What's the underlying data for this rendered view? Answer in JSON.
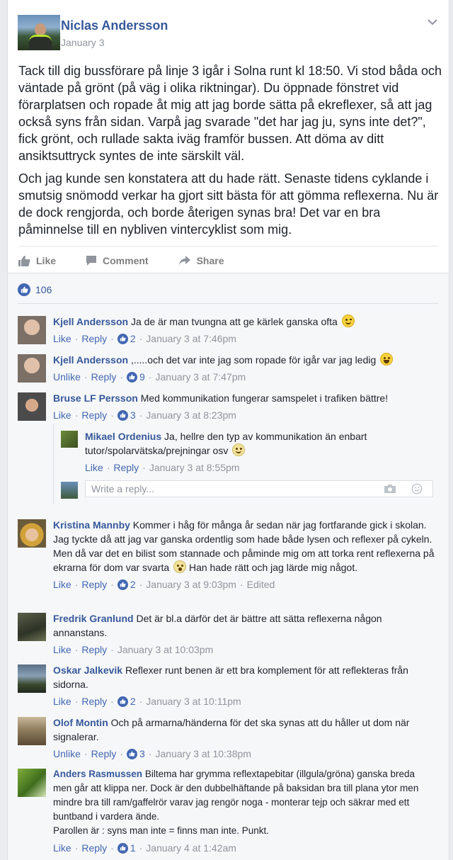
{
  "post": {
    "author": "Niclas Andersson",
    "date": "January 3",
    "paragraph1": "Tack till dig bussförare på linje 3 igår i Solna runt kl 18:50. Vi stod båda och väntade på grönt (på väg i olika riktningar). Du öppnade fönstret vid förarplatsen och ropade åt mig att jag borde sätta på ekreflexer, så att jag också syns från sidan. Varpå jag svarade \"det har jag ju, syns inte det?\", fick grönt, och rullade sakta iväg framför bussen. Att döma av ditt ansiktsuttryck syntes de inte särskilt väl.",
    "paragraph2": "Och jag kunde sen konstatera att du hade rätt. Senaste tidens cyklande i smutsig snömodd verkar ha gjort sitt bästa för att gömma reflexerna. Nu är de dock rengjorda, och borde återigen synas bra! Det var en bra påminnelse till en nybliven vintercyklist som mig.",
    "actions": {
      "like": "Like",
      "comment": "Comment",
      "share": "Share"
    }
  },
  "likes_count": "106",
  "colors": {
    "link": "#365899",
    "meta": "#90949c",
    "like_blue": "#4267b2",
    "background": "#e9ebee"
  },
  "comments": [
    {
      "name": "Kjell Andersson",
      "text": "Ja de är man tvungna att ge kärlek ganska ofta",
      "emoji": "wink-icon",
      "like_label": "Like",
      "reply_label": "Reply",
      "likes": "2",
      "time": "January 3 at 7:46pm"
    },
    {
      "name": "Kjell Andersson",
      "text": ",.....och det var inte jag som ropade för igår var jag ledig",
      "emoji": "grin-icon",
      "like_label": "Unlike",
      "reply_label": "Reply",
      "likes": "9",
      "time": "January 3 at 7:47pm"
    },
    {
      "name": "Bruse LF Persson",
      "text": "Med kommunikation fungerar samspelet i trafiken bättre!",
      "like_label": "Like",
      "reply_label": "Reply",
      "likes": "3",
      "time": "January 3 at 8:23pm"
    },
    {
      "name": "Kristina Mannby",
      "text": "Kommer i håg för många år sedan när jag fortfarande gick i skolan. Jag tyckte då att jag var ganska ordentlig som hade både lysen och reflexer på cykeln. Men då var det en bilist som stannade och påminde mig om att torka rent reflexerna på ekrarna för dom var svarta",
      "text_after": "Han hade rätt och jag lärde mig något.",
      "emoji": "surprised-icon",
      "like_label": "Like",
      "reply_label": "Reply",
      "likes": "2",
      "time": "January 3 at 9:03pm",
      "edited": "Edited"
    },
    {
      "name": "Fredrik Granlund",
      "text": "Det är bl.a därför det är bättre att sätta reflexerna någon annanstans.",
      "like_label": "Like",
      "reply_label": "Reply",
      "time": "January 3 at 10:03pm"
    },
    {
      "name": "Oskar Jalkevik",
      "text": "Reflexer runt benen är ett bra komplement för att reflekteras från sidorna.",
      "like_label": "Like",
      "reply_label": "Reply",
      "likes": "2",
      "time": "January 3 at 10:11pm"
    },
    {
      "name": "Olof Montin",
      "text": "Och på armarna/händerna för det ska synas att du håller ut dom när signalerar.",
      "like_label": "Unlike",
      "reply_label": "Reply",
      "likes": "3",
      "time": "January 3 at 10:38pm"
    },
    {
      "name": "Anders Rasmussen",
      "text": "Biltema har grymma reflextapebitar (illgula/gröna) ganska breda men går att klippa ner. Dock är den dubbelhäftande på baksidan bra till plana ytor men mindre bra till ram/gaffelrör varav jag rengör noga - monterar tejp och säkrar med ett buntband i vardera ände.",
      "text2": "Parollen är : syns man inte = finns man inte. Punkt.",
      "like_label": "Like",
      "reply_label": "Reply",
      "likes": "1",
      "time": "January 4 at 1:42am"
    }
  ],
  "reply": {
    "name": "Mikael Ordenius",
    "text": "Ja, hellre den typ av kommunikation än enbart tutor/spolarvätska/prejningar osv",
    "emoji": "smile-icon",
    "like_label": "Like",
    "reply_label": "Reply",
    "time": "January 3 at 8:55pm"
  },
  "reply_box": {
    "placeholder": "Write a reply..."
  }
}
